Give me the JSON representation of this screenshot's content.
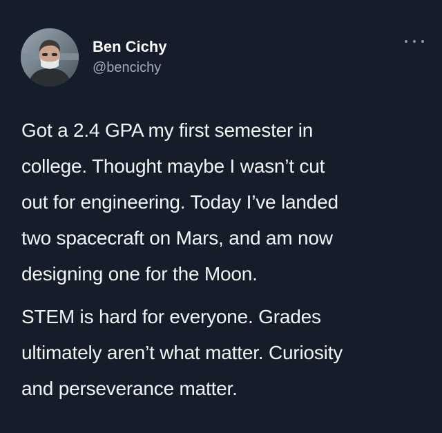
{
  "tweet": {
    "author": {
      "display_name": "Ben Cichy",
      "handle": "@bencichy",
      "avatar_icon": "profile-photo"
    },
    "more_icon": "more-horizontal-icon",
    "paragraphs": [
      [
        "Got a 2.4 GPA my first semester in",
        "college. Thought maybe I wasn’t cut",
        "out for engineering. Today I’ve landed",
        "two spacecraft on Mars, and am now",
        "designing one for the Moon."
      ],
      [
        "STEM is hard for everyone. Grades",
        "ultimately aren’t what matter.  Curiosity",
        "and perseverance matter."
      ]
    ]
  },
  "colors": {
    "background": "#141d29",
    "text": "#f2f4f6",
    "secondary_text": "#a3adb8"
  }
}
